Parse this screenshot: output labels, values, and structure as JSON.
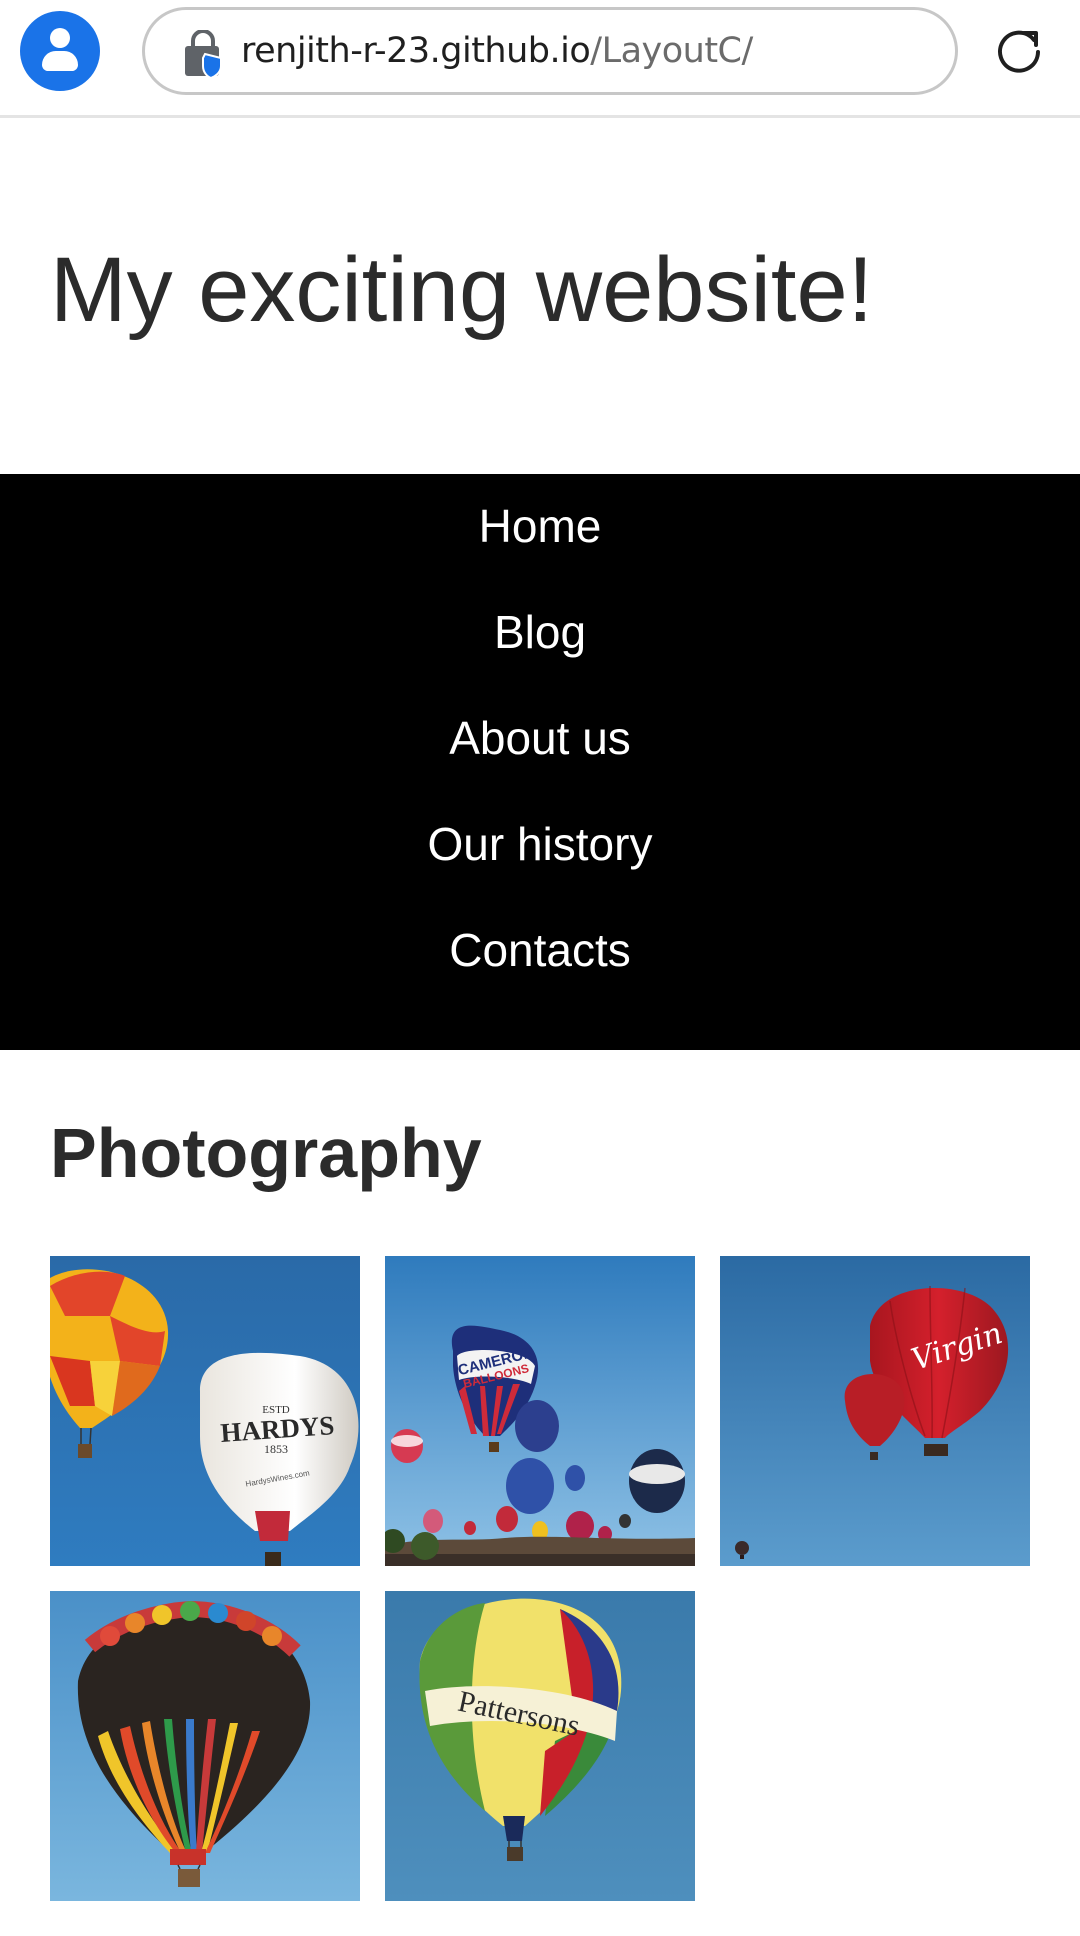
{
  "browser": {
    "url_host": "renjith-r-23.github.io",
    "url_path": "/LayoutC/",
    "accent_color": "#1a73e8"
  },
  "header": {
    "title": "My exciting website!"
  },
  "nav": {
    "items": [
      {
        "label": "Home"
      },
      {
        "label": "Blog"
      },
      {
        "label": "About us"
      },
      {
        "label": "Our history"
      },
      {
        "label": "Contacts"
      }
    ]
  },
  "main": {
    "section_title": "Photography",
    "photos": [
      {
        "subject": "balloons-photo",
        "logo_text": "HARDYS",
        "logo_sub": "ESTD",
        "logo_year": "1853",
        "logo_web": "HardysWines.com"
      },
      {
        "subject": "balloons-photo",
        "logo_text": "CAMERON",
        "logo_sub": "BALLOONS"
      },
      {
        "subject": "balloons-photo",
        "logo_text": "Virgin"
      },
      {
        "subject": "balloons-photo"
      },
      {
        "subject": "balloons-photo",
        "logo_text": "Pattersons"
      }
    ]
  }
}
